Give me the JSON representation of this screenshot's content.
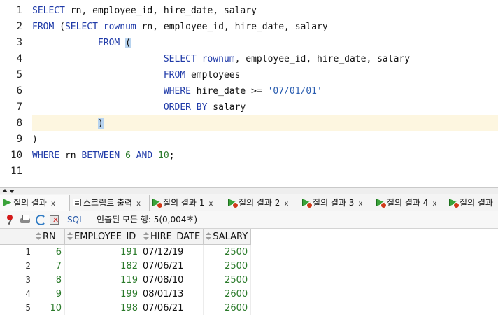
{
  "editor": {
    "line_numbers": [
      "1",
      "2",
      "3",
      "4",
      "5",
      "6",
      "7",
      "8",
      "9",
      "10",
      "11"
    ],
    "lines": [
      [
        {
          "t": "SELECT",
          "c": "kw"
        },
        {
          "t": " rn, employee_id, hire_date, salary",
          "c": ""
        }
      ],
      [
        {
          "t": "FROM",
          "c": "kw"
        },
        {
          "t": " (",
          "c": ""
        },
        {
          "t": "SELECT",
          "c": "kw"
        },
        {
          "t": " ",
          "c": ""
        },
        {
          "t": "rownum",
          "c": "kw"
        },
        {
          "t": " rn, employee_id, hire_date, salary",
          "c": ""
        }
      ],
      [
        {
          "t": "            ",
          "c": ""
        },
        {
          "t": "FROM",
          "c": "kw"
        },
        {
          "t": " ",
          "c": ""
        },
        {
          "t": "(",
          "c": "paren-hl"
        }
      ],
      [
        {
          "t": "                        ",
          "c": ""
        },
        {
          "t": "SELECT",
          "c": "kw"
        },
        {
          "t": " ",
          "c": ""
        },
        {
          "t": "rownum",
          "c": "kw"
        },
        {
          "t": ", employee_id, hire_date, salary",
          "c": ""
        }
      ],
      [
        {
          "t": "                        ",
          "c": ""
        },
        {
          "t": "FROM",
          "c": "kw"
        },
        {
          "t": " employees",
          "c": ""
        }
      ],
      [
        {
          "t": "                        ",
          "c": ""
        },
        {
          "t": "WHERE",
          "c": "kw"
        },
        {
          "t": " hire_date >= ",
          "c": ""
        },
        {
          "t": "'07/01/01'",
          "c": "str"
        }
      ],
      [
        {
          "t": "                        ",
          "c": ""
        },
        {
          "t": "ORDER BY",
          "c": "kw"
        },
        {
          "t": " salary",
          "c": ""
        }
      ],
      [
        {
          "t": "            ",
          "c": ""
        },
        {
          "t": ")",
          "c": "paren-hl"
        }
      ],
      [
        {
          "t": ")",
          "c": ""
        }
      ],
      [
        {
          "t": "WHERE",
          "c": "kw"
        },
        {
          "t": " rn ",
          "c": ""
        },
        {
          "t": "BETWEEN",
          "c": "kw"
        },
        {
          "t": " ",
          "c": ""
        },
        {
          "t": "6",
          "c": "num"
        },
        {
          "t": " ",
          "c": ""
        },
        {
          "t": "AND",
          "c": "kw"
        },
        {
          "t": " ",
          "c": ""
        },
        {
          "t": "10",
          "c": "num"
        },
        {
          "t": ";",
          "c": ""
        }
      ],
      []
    ]
  },
  "tabs": [
    {
      "label": "질의 결과",
      "icon": "grid-icon",
      "error": false,
      "close": "x",
      "active": true
    },
    {
      "label": "스크립트 출력",
      "icon": "script-icon",
      "error": false,
      "close": "x",
      "active": false
    },
    {
      "label": "질의 결과 1",
      "icon": "grid-icon",
      "error": true,
      "close": "x",
      "active": false
    },
    {
      "label": "질의 결과 2",
      "icon": "grid-icon",
      "error": true,
      "close": "x",
      "active": false
    },
    {
      "label": "질의 결과 3",
      "icon": "grid-icon",
      "error": true,
      "close": "x",
      "active": false
    },
    {
      "label": "질의 결과 4",
      "icon": "grid-icon",
      "error": true,
      "close": "x",
      "active": false
    },
    {
      "label": "질의 결과",
      "icon": "grid-icon",
      "error": true,
      "close": "",
      "active": false
    }
  ],
  "toolbar": {
    "sql_label": "SQL",
    "status": "인출된 모든 행: 5(0,004초)"
  },
  "grid": {
    "columns": [
      "RN",
      "EMPLOYEE_ID",
      "HIRE_DATE",
      "SALARY"
    ],
    "rows": [
      {
        "num": "1",
        "cells": [
          "6",
          "191",
          "07/12/19",
          "2500"
        ]
      },
      {
        "num": "2",
        "cells": [
          "7",
          "182",
          "07/06/21",
          "2500"
        ]
      },
      {
        "num": "3",
        "cells": [
          "8",
          "119",
          "07/08/10",
          "2500"
        ]
      },
      {
        "num": "4",
        "cells": [
          "9",
          "199",
          "08/01/13",
          "2600"
        ]
      },
      {
        "num": "5",
        "cells": [
          "10",
          "198",
          "07/06/21",
          "2600"
        ]
      }
    ]
  }
}
